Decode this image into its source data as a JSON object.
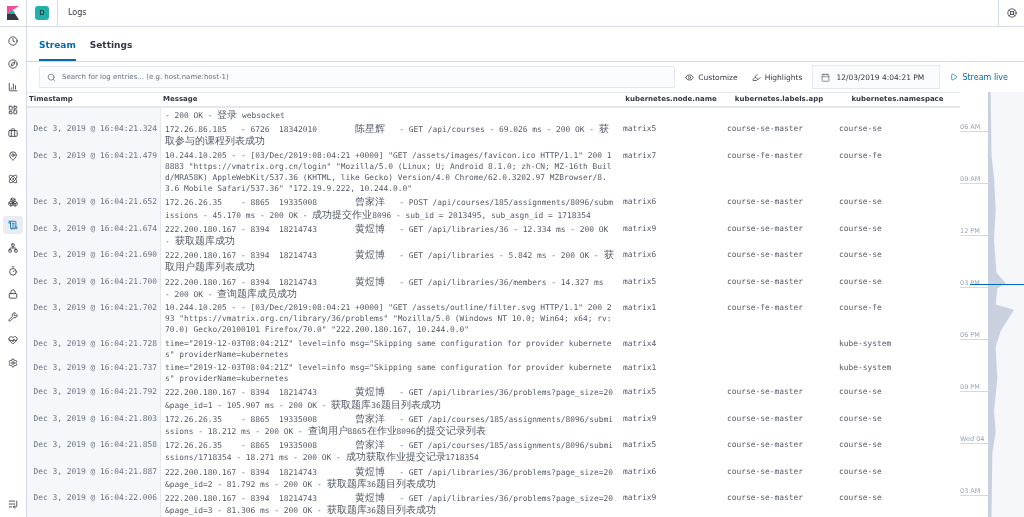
{
  "header": {
    "space_initial": "D",
    "breadcrumb": "Logs"
  },
  "sidebar": {
    "items": [
      {
        "selected": false
      },
      {
        "selected": false
      },
      {
        "selected": false
      },
      {
        "selected": false
      },
      {
        "selected": false
      },
      {
        "selected": false
      },
      {
        "selected": false
      },
      {
        "selected": false
      },
      {
        "selected": true
      },
      {
        "selected": false
      },
      {
        "selected": false
      },
      {
        "selected": false
      },
      {
        "selected": false
      },
      {
        "selected": false
      },
      {
        "selected": false
      }
    ]
  },
  "tabs": [
    {
      "label": "Stream",
      "selected": true
    },
    {
      "label": "Settings",
      "selected": false
    }
  ],
  "toolbar": {
    "search": {
      "placeholder": "Search for log entries... (e.g. host.name:host-1)"
    },
    "customize": "Customize",
    "highlights": "Highlights",
    "date": "12/03/2019 4:04:21 PM",
    "stream_live": "Stream live"
  },
  "table": {
    "columns": [
      "Timestamp",
      "Message",
      "kubernetes.node.name",
      "kubernetes.labels.app",
      "kubernetes.namespace"
    ],
    "rows": [
      {
        "message": "- 200 OK - 登录 websocket"
      },
      {
        "timestamp": "Dec 3, 2019 @ 16:04:21.324",
        "message": "172.26.86.185   - 6726  18342010        陈星辉   - GET /api/courses - 69.026 ms - 200 OK - 获取参与的课程列表成功",
        "node": "matrix5",
        "app": "course-se-master",
        "namespace": "course-se"
      },
      {
        "timestamp": "Dec 3, 2019 @ 16:04:21.479",
        "message": "10.244.10.205 - - [03/Dec/2019:08:04:21 +0000] \"GET /assets/images/favicon.ico HTTP/1.1\" 200 18883 \"https://vmatrix.org.cn/login\" \"Mozilla/5.0 (Linux; U; Android 8.1.0; zh-CN; MZ-16th Build/MRA58K) AppleWebKit/537.36 (KHTML, like Gecko) Version/4.0 Chrome/62.0.3202.97 MZBrowser/8.3.6 Mobile Safari/537.36\" \"172.19.9.222, 10.244.0.0\"",
        "node": "matrix7",
        "app": "course-fe-master",
        "namespace": "course-fe"
      },
      {
        "timestamp": "Dec 3, 2019 @ 16:04:21.652",
        "message": "172.26.26.35    - 8865  19335008        曾家洋   - POST /api/courses/185/assignments/8096/submissions - 45.170 ms - 200 OK - 成功提交作业8096 - sub_id = 2013495, sub_asgn_id = 1718354",
        "node": "matrix6",
        "app": "course-se-master",
        "namespace": "course-se"
      },
      {
        "timestamp": "Dec 3, 2019 @ 16:04:21.674",
        "message": "222.200.180.167 - 8394  18214743        黄煜博   - GET /api/libraries/36 - 12.334 ms - 200 OK - 获取题库成功",
        "node": "matrix9",
        "app": "course-se-master",
        "namespace": "course-se"
      },
      {
        "timestamp": "Dec 3, 2019 @ 16:04:21.690",
        "message": "222.200.180.167 - 8394  18214743        黄煜博   - GET /api/libraries - 5.842 ms - 200 OK - 获取用户题库列表成功",
        "node": "matrix6",
        "app": "course-se-master",
        "namespace": "course-se"
      },
      {
        "timestamp": "Dec 3, 2019 @ 16:04:21.700",
        "message": "222.200.180.167 - 8394  18214743        黄煜博   - GET /api/libraries/36/members - 14.327 ms - 200 OK - 查询题库成员成功",
        "node": "matrix5",
        "app": "course-se-master",
        "namespace": "course-se"
      },
      {
        "timestamp": "Dec 3, 2019 @ 16:04:21.702",
        "message": "10.244.10.205 - - [03/Dec/2019:08:04:21 +0000] \"GET /assets/outline/filter.svg HTTP/1.1\" 200 293 \"https://vmatrix.org.cn/library/36/problems\" \"Mozilla/5.0 (Windows NT 10.0; Win64; x64; rv:70.0) Gecko/20100101 Firefox/70.0\" \"222.200.180.167, 10.244.0.0\"",
        "node": "matrix1",
        "app": "course-fe-master",
        "namespace": "course-fe"
      },
      {
        "timestamp": "Dec 3, 2019 @ 16:04:21.728",
        "message": "time=\"2019-12-03T08:04:21Z\" level=info msg=\"Skipping same configuration for provider kubernetes\" providerName=kubernetes",
        "node": "matrix4",
        "namespace": "kube-system"
      },
      {
        "timestamp": "Dec 3, 2019 @ 16:04:21.737",
        "message": "time=\"2019-12-03T08:04:21Z\" level=info msg=\"Skipping same configuration for provider kubernetes\" providerName=kubernetes",
        "node": "matrix1",
        "namespace": "kube-system"
      },
      {
        "timestamp": "Dec 3, 2019 @ 16:04:21.792",
        "message": "222.200.180.167 - 8394  18214743        黄煜博   - GET /api/libraries/36/problems?page_size=20&page_id=1 - 105.907 ms - 200 OK - 获取题库36题目列表成功",
        "node": "matrix5",
        "app": "course-se-master",
        "namespace": "course-se"
      },
      {
        "timestamp": "Dec 3, 2019 @ 16:04:21.803",
        "message": "172.26.26.35    - 8865  19335008        曾家洋   - GET /api/courses/185/assignments/8096/submissions - 18.212 ms - 200 OK - 查询用户8865在作业8096的提交记录列表",
        "node": "matrix9",
        "app": "course-se-master",
        "namespace": "course-se"
      },
      {
        "timestamp": "Dec 3, 2019 @ 16:04:21.858",
        "message": "172.26.26.35    - 8865  19335008        曾家洋   - GET /api/courses/185/assignments/8096/submissions/1718354 - 18.271 ms - 200 OK - 成功获取作业提交记录1718354",
        "node": "matrix5",
        "app": "course-se-master",
        "namespace": "course-se"
      },
      {
        "timestamp": "Dec 3, 2019 @ 16:04:21.887",
        "message": "222.200.180.167 - 8394  18214743        黄煜博   - GET /api/libraries/36/problems?page_size=20&page_id=2 - 81.792 ms - 200 OK - 获取题库36题目列表成功",
        "node": "matrix6",
        "app": "course-se-master",
        "namespace": "course-se"
      },
      {
        "timestamp": "Dec 3, 2019 @ 16:04:22.006",
        "message": "222.200.180.167 - 8394  18214743        黄煜博   - GET /api/libraries/36/problems?page_size=20&page_id=3 - 81.306 ms - 200 OK - 获取题库36题目列表成功",
        "node": "matrix9",
        "app": "course-se-master",
        "namespace": "course-se"
      }
    ]
  },
  "minimap": {
    "labels": [
      "06 AM",
      "09 AM",
      "12 PM",
      "03 PM",
      "06 PM",
      "09 PM",
      "Wed 04",
      "03 AM"
    ]
  }
}
